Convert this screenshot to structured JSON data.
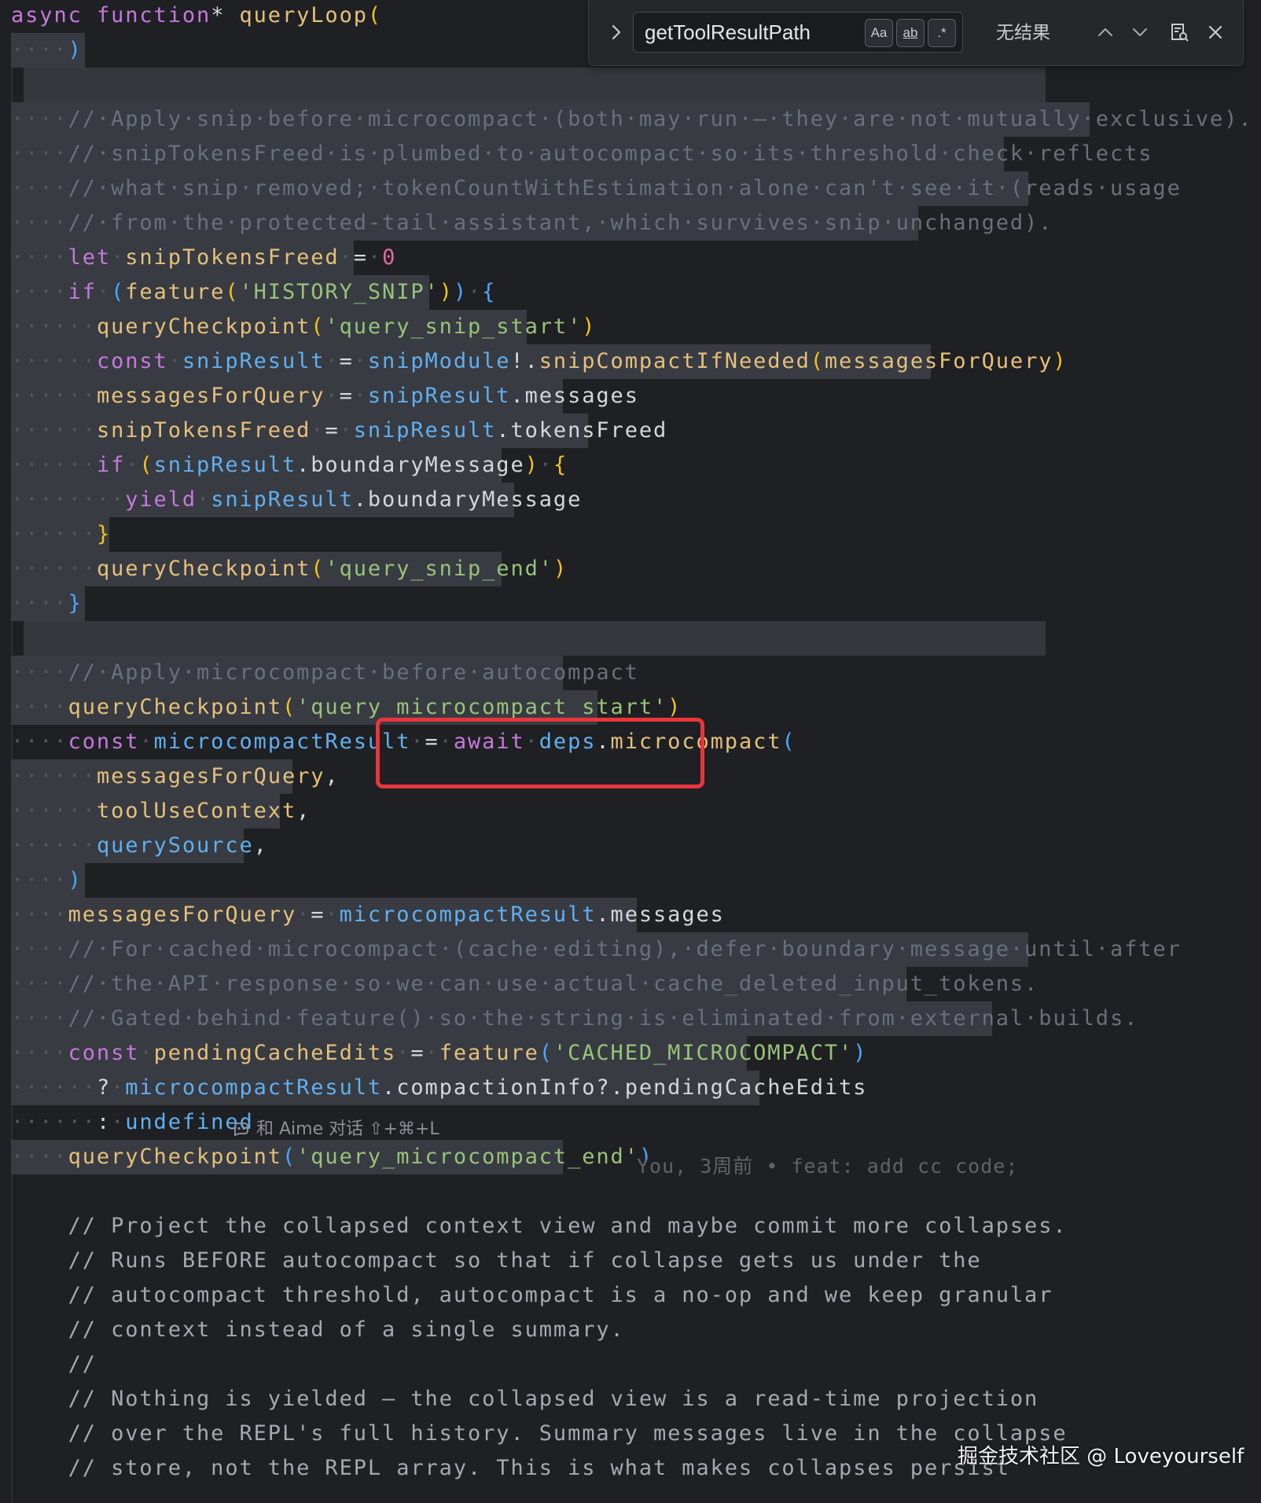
{
  "find_widget": {
    "query": "getToolResultPath",
    "match_case_label": "Aa",
    "whole_word_label": "ab",
    "regex_label": ".*",
    "result_text": "无结果"
  },
  "code_lines": [
    [
      [
        "kw",
        "async "
      ],
      [
        "kw",
        "function"
      ],
      [
        "pl",
        "* "
      ],
      [
        "fn",
        "queryLoop"
      ],
      [
        "br1",
        "("
      ]
    ],
    [
      [
        "ws",
        "····"
      ],
      [
        "br2",
        ")"
      ]
    ],
    [],
    [
      [
        "ws",
        "····"
      ],
      [
        "cm",
        "//·Apply·snip·before·microcompact·(both·may·run·—·they·are·not·mutually·exclusive)."
      ]
    ],
    [
      [
        "ws",
        "····"
      ],
      [
        "cm",
        "//·snipTokensFreed·is·plumbed·to·autocompact·so·its·threshold·check·reflects"
      ]
    ],
    [
      [
        "ws",
        "····"
      ],
      [
        "cm",
        "//·what·snip·removed;·tokenCountWithEstimation·alone·can't·see·it·(reads·usage"
      ]
    ],
    [
      [
        "ws",
        "····"
      ],
      [
        "cm",
        "//·from·the·protected-tail·assistant,·which·survives·snip·unchanged)."
      ]
    ],
    [
      [
        "ws",
        "····"
      ],
      [
        "kw",
        "let"
      ],
      [
        "ws",
        "·"
      ],
      [
        "fn",
        "snipTokensFreed"
      ],
      [
        "ws",
        "·"
      ],
      [
        "pl",
        "="
      ],
      [
        "ws",
        "·"
      ],
      [
        "num",
        "0"
      ]
    ],
    [
      [
        "ws",
        "····"
      ],
      [
        "kw",
        "if"
      ],
      [
        "ws",
        "·"
      ],
      [
        "br2",
        "("
      ],
      [
        "fn",
        "feature"
      ],
      [
        "br1",
        "("
      ],
      [
        "str",
        "'HISTORY_SNIP'"
      ],
      [
        "br1",
        ")"
      ],
      [
        "br2",
        ")"
      ],
      [
        "ws",
        "·"
      ],
      [
        "br2",
        "{"
      ]
    ],
    [
      [
        "ws",
        "······"
      ],
      [
        "fn",
        "queryCheckpoint"
      ],
      [
        "br1",
        "("
      ],
      [
        "str",
        "'query_snip_start'"
      ],
      [
        "br1",
        ")"
      ]
    ],
    [
      [
        "ws",
        "······"
      ],
      [
        "kw",
        "const"
      ],
      [
        "ws",
        "·"
      ],
      [
        "var",
        "snipResult"
      ],
      [
        "ws",
        "·"
      ],
      [
        "pl",
        "="
      ],
      [
        "ws",
        "·"
      ],
      [
        "var",
        "snipModule"
      ],
      [
        "pl",
        "!."
      ],
      [
        "fn",
        "snipCompactIfNeeded"
      ],
      [
        "br1",
        "("
      ],
      [
        "fn",
        "messagesForQuery"
      ],
      [
        "br1",
        ")"
      ]
    ],
    [
      [
        "ws",
        "······"
      ],
      [
        "fn",
        "messagesForQuery"
      ],
      [
        "ws",
        "·"
      ],
      [
        "pl",
        "="
      ],
      [
        "ws",
        "·"
      ],
      [
        "var",
        "snipResult"
      ],
      [
        "pl",
        ".messages"
      ]
    ],
    [
      [
        "ws",
        "······"
      ],
      [
        "fn",
        "snipTokensFreed"
      ],
      [
        "ws",
        "·"
      ],
      [
        "pl",
        "="
      ],
      [
        "ws",
        "·"
      ],
      [
        "var",
        "snipResult"
      ],
      [
        "pl",
        ".tokensFreed"
      ]
    ],
    [
      [
        "ws",
        "······"
      ],
      [
        "kw",
        "if"
      ],
      [
        "ws",
        "·"
      ],
      [
        "br1",
        "("
      ],
      [
        "var",
        "snipResult"
      ],
      [
        "pl",
        ".boundaryMessage"
      ],
      [
        "br1",
        ")"
      ],
      [
        "ws",
        "·"
      ],
      [
        "br1",
        "{"
      ]
    ],
    [
      [
        "ws",
        "········"
      ],
      [
        "kw",
        "yield"
      ],
      [
        "ws",
        "·"
      ],
      [
        "var",
        "snipResult"
      ],
      [
        "pl",
        ".boundaryMessage"
      ]
    ],
    [
      [
        "ws",
        "······"
      ],
      [
        "br1",
        "}"
      ]
    ],
    [
      [
        "ws",
        "······"
      ],
      [
        "fn",
        "queryCheckpoint"
      ],
      [
        "br1",
        "("
      ],
      [
        "str",
        "'query_snip_end'"
      ],
      [
        "br1",
        ")"
      ]
    ],
    [
      [
        "ws",
        "····"
      ],
      [
        "br2",
        "}"
      ]
    ],
    [],
    [
      [
        "ws",
        "····"
      ],
      [
        "cm",
        "//·Apply·microcompact·before·autocompact"
      ]
    ],
    [
      [
        "ws",
        "····"
      ],
      [
        "fn",
        "queryCheckpoint"
      ],
      [
        "br1",
        "("
      ],
      [
        "str",
        "'query_microcompact_start'"
      ],
      [
        "br1",
        ")"
      ]
    ],
    [
      [
        "ws",
        "····"
      ],
      [
        "kw",
        "const"
      ],
      [
        "ws",
        "·"
      ],
      [
        "var",
        "microcompactResult"
      ],
      [
        "ws",
        "·"
      ],
      [
        "pl",
        "="
      ],
      [
        "ws",
        "·"
      ],
      [
        "kw",
        "await"
      ],
      [
        "ws",
        "·"
      ],
      [
        "var",
        "deps"
      ],
      [
        "pl",
        "."
      ],
      [
        "fn",
        "microcompact"
      ],
      [
        "br2",
        "("
      ]
    ],
    [
      [
        "ws",
        "······"
      ],
      [
        "fn",
        "messagesForQuery"
      ],
      [
        "pl",
        ","
      ]
    ],
    [
      [
        "ws",
        "······"
      ],
      [
        "fn",
        "toolUseContext"
      ],
      [
        "pl",
        ","
      ]
    ],
    [
      [
        "ws",
        "······"
      ],
      [
        "var",
        "querySource"
      ],
      [
        "pl",
        ","
      ]
    ],
    [
      [
        "ws",
        "····"
      ],
      [
        "br2",
        ")"
      ]
    ],
    [
      [
        "ws",
        "····"
      ],
      [
        "fn",
        "messagesForQuery"
      ],
      [
        "ws",
        "·"
      ],
      [
        "pl",
        "="
      ],
      [
        "ws",
        "·"
      ],
      [
        "var",
        "microcompactResult"
      ],
      [
        "pl",
        ".messages"
      ]
    ],
    [
      [
        "ws",
        "····"
      ],
      [
        "cm",
        "//·For·cached·microcompact·(cache·editing),·defer·boundary·message·until·after"
      ]
    ],
    [
      [
        "ws",
        "····"
      ],
      [
        "cm",
        "//·the·API·response·so·we·can·use·actual·cache_deleted_input_tokens."
      ]
    ],
    [
      [
        "ws",
        "····"
      ],
      [
        "cm",
        "//·Gated·behind·feature()·so·the·string·is·eliminated·from·external·builds."
      ]
    ],
    [
      [
        "ws",
        "····"
      ],
      [
        "kw",
        "const"
      ],
      [
        "ws",
        "·"
      ],
      [
        "fn",
        "pendingCacheEdits"
      ],
      [
        "ws",
        "·"
      ],
      [
        "pl",
        "="
      ],
      [
        "ws",
        "·"
      ],
      [
        "fn",
        "feature"
      ],
      [
        "br2",
        "("
      ],
      [
        "str",
        "'CACHED_MICROCOMPACT'"
      ],
      [
        "br2",
        ")"
      ]
    ],
    [
      [
        "ws",
        "······"
      ],
      [
        "pl",
        "?"
      ],
      [
        "ws",
        "·"
      ],
      [
        "var",
        "microcompactResult"
      ],
      [
        "pl",
        ".compactionInfo?.pendingCacheEdits"
      ]
    ],
    [
      [
        "ws",
        "······"
      ],
      [
        "pl",
        ":"
      ],
      [
        "ws",
        "·"
      ],
      [
        "var",
        "undefined"
      ]
    ],
    [
      [
        "ws",
        "····"
      ],
      [
        "fn",
        "queryCheckpoint"
      ],
      [
        "br2",
        "("
      ],
      [
        "str",
        "'query_microcompact_end'"
      ],
      [
        "br2",
        ")"
      ]
    ],
    [],
    [
      [
        "pl",
        "    "
      ],
      [
        "cm2",
        "// Project the collapsed context view and maybe commit more collapses."
      ]
    ],
    [
      [
        "pl",
        "    "
      ],
      [
        "cm2",
        "// Runs BEFORE autocompact so that if collapse gets us under the"
      ]
    ],
    [
      [
        "pl",
        "    "
      ],
      [
        "cm2",
        "// autocompact threshold, autocompact is a no-op and we keep granular"
      ]
    ],
    [
      [
        "pl",
        "    "
      ],
      [
        "cm2",
        "// context instead of a single summary."
      ]
    ],
    [
      [
        "pl",
        "    "
      ],
      [
        "cm2",
        "//"
      ]
    ],
    [
      [
        "pl",
        "    "
      ],
      [
        "cm2",
        "// Nothing is yielded — the collapsed view is a read-time projection"
      ]
    ],
    [
      [
        "pl",
        "    "
      ],
      [
        "cm2",
        "// over the REPL's full history. Summary messages live in the collapse"
      ]
    ],
    [
      [
        "pl",
        "    "
      ],
      [
        "cm2",
        "// store, not the REPL array. This is what makes collapses persist"
      ]
    ]
  ],
  "inline_hint": {
    "ai_chat": "和 Aime 对话 ⇧+⌘+L",
    "blame": "You, 3周前 • feat: add cc code;"
  },
  "watermark": "掘金技术社区 @ Loveyourself"
}
